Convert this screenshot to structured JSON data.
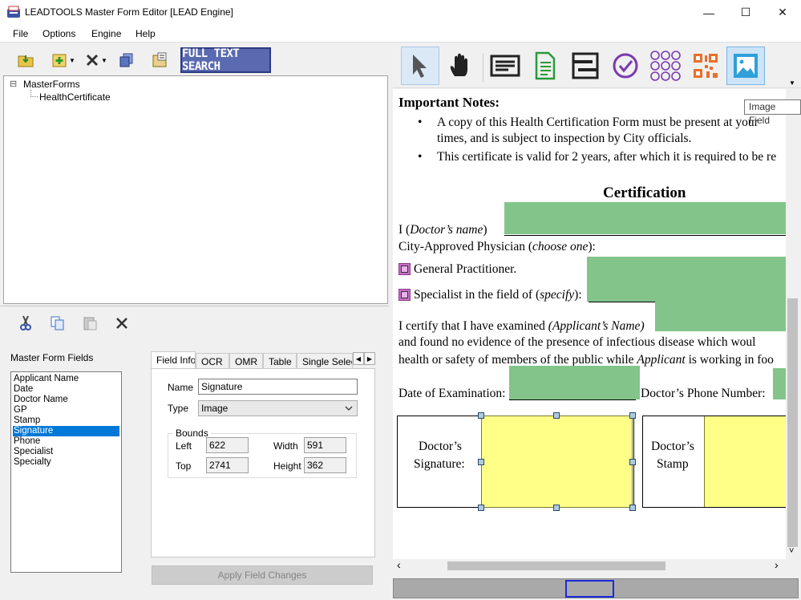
{
  "window": {
    "title": "LEADTOOLS Master Form Editor [LEAD Engine]",
    "minimize": "—",
    "maximize": "☐",
    "close": "✕"
  },
  "menu": [
    "File",
    "Options",
    "Engine",
    "Help"
  ],
  "left_toolbar": {
    "full_text_search": "FULL TEXT SEARCH"
  },
  "tree": {
    "root": "MasterForms",
    "child": "HealthCertificate",
    "expander": "⊟"
  },
  "fields": {
    "label": "Master Form Fields",
    "items": [
      "Applicant Name",
      "Date",
      "Doctor Name",
      "GP",
      "Stamp",
      "Signature",
      "Phone",
      "Specialist",
      "Specialty"
    ],
    "selected": "Signature"
  },
  "tabs": [
    "Field Info",
    "OCR",
    "OMR",
    "Table",
    "Single Selec"
  ],
  "field_info": {
    "name_label": "Name",
    "name_value": "Signature",
    "type_label": "Type",
    "type_value": "Image",
    "bounds_label": "Bounds",
    "left_label": "Left",
    "left_value": "622",
    "top_label": "Top",
    "top_value": "2741",
    "width_label": "Width",
    "width_value": "591",
    "height_label": "Height",
    "height_value": "362"
  },
  "apply_button": "Apply Field Changes",
  "tooltip": "Image Field",
  "document": {
    "notes_title": "Important Notes:",
    "bullet1_a": "A copy of this Health Certification Form must be present at your",
    "bullet1_b": "times, and is subject to inspection by City officials.",
    "bullet2": "This certificate is valid for 2 years, after which it is required to be re",
    "heading": "Certification",
    "line_i_pre": "I (",
    "line_i_italic": "Doctor’s  name",
    "line_i_post": ")",
    "city_pre": "City-Approved Physician (",
    "city_italic": "choose one",
    "city_post": "):",
    "gp": "General Practitioner.",
    "spec_pre": "Specialist in the field of (",
    "spec_italic": "specify",
    "spec_post": "):",
    "certify_pre": "I certify that I have examined ",
    "certify_italic": "(Applicant’s Name)",
    "line2": "and found no evidence of the presence of infectious disease which woul",
    "line3_pre": "health or safety of members of the public while ",
    "line3_italic": "Applicant",
    "line3_post": " is working in foo",
    "exam": "Date of Examination:",
    "phone": "Doctor’s Phone Number:",
    "sig_l1": "Doctor’s",
    "sig_l2": "Signature:",
    "stamp_l1": "Doctor’s",
    "stamp_l2": "Stamp"
  },
  "scroll": {
    "left": "‹",
    "right": "›",
    "up": "˄",
    "down": "˅"
  },
  "colors": {
    "field_fill": "#82c48a",
    "selected_field": "#ffff88",
    "accent": "#0078d7",
    "checkbox": "#c86ec8"
  }
}
